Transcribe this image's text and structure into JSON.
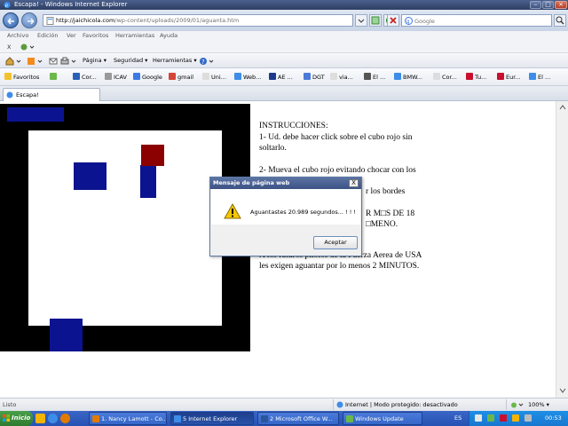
{
  "window": {
    "title": "Escapa! - Windows Internet Explorer"
  },
  "address": {
    "host": "http://jaichicola.com",
    "path": "/wp-content/uploads/2009/01/aguanta.htm"
  },
  "search": {
    "placeholder": "Google"
  },
  "menu": [
    "Archivo",
    "Edición",
    "Ver",
    "Favoritos",
    "Herramientas",
    "Ayuda"
  ],
  "link_row": {
    "close": "X"
  },
  "command_bar": {
    "page": "Página ▾",
    "security": "Seguridad ▾",
    "tools": "Herramientas ▾"
  },
  "favorites": {
    "label": "Favoritos",
    "items": [
      "Cor...",
      "ICAV",
      "Google",
      "gmail",
      "Uni...",
      "Web...",
      "AE ...",
      "DGT",
      "via...",
      "El ...",
      "BMW...",
      "Cor...",
      "Tu...",
      "Eur...",
      "El ..."
    ]
  },
  "tab": {
    "label": "Escapa!"
  },
  "page": {
    "instructions": [
      "INSTRUCCIONES:",
      "1- Ud. debe hacer click sobre el cubo rojo sin soltarlo.",
      "2- Mueva el cubo rojo evitando chocar con los",
      "r los bordes",
      "R M□S DE 18",
      "□MENO.",
      "A los futuros pilotos de la Fuerza Aerea de USA les exigen aguantar por lo menos 2 MINUTOS."
    ]
  },
  "dialog": {
    "title": "Mensaje de página web",
    "message": "Aguantastes 20.989 segundos... ! ! !",
    "ok": "Aceptar",
    "close": "X"
  },
  "status": {
    "left": "Listo",
    "zone": "Internet | Modo protegido: desactivado",
    "zoom": "100% ▾"
  },
  "taskbar": {
    "start": "Inicio",
    "buttons": [
      "1. Nancy Lamott - Co...",
      "5 Internet Explorer",
      "2 Microsoft Office W...",
      "Windows Update"
    ],
    "lang": "ES",
    "clock": "00:53"
  },
  "colors": {
    "game_border": "#000000",
    "blue_block": "#0b1390",
    "red_cube": "#8b0000",
    "titlebar": "#3a4d77"
  }
}
